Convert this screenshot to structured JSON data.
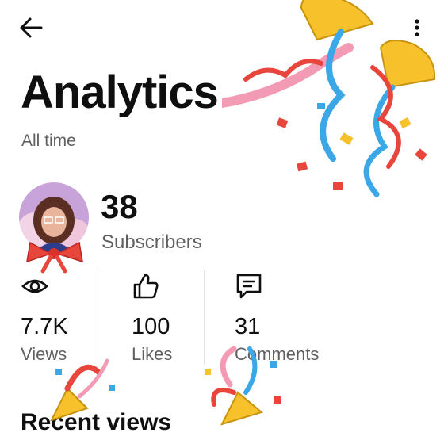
{
  "header": {
    "back_icon": "arrow-left-icon",
    "menu_icon": "more-vert-icon"
  },
  "page": {
    "title": "Analytics",
    "subtitle": "All time"
  },
  "channel": {
    "subscribers_value": "38",
    "subscribers_label": "Subscribers"
  },
  "stats": [
    {
      "icon": "eye-icon",
      "value": "7.7K",
      "label": "Views"
    },
    {
      "icon": "thumbs-up-icon",
      "value": "100",
      "label": "Likes"
    },
    {
      "icon": "comment-icon",
      "value": "31",
      "label": "Comments"
    }
  ],
  "sections": {
    "recent_views": "Recent views"
  },
  "colors": {
    "text": "#0f0f0f",
    "secondary": "#606060",
    "divider": "#e5e5e5",
    "confetti_red": "#e8453c",
    "confetti_blue": "#3ba7e6",
    "confetti_yellow": "#f6c12b",
    "confetti_pink": "#f39ab4"
  }
}
